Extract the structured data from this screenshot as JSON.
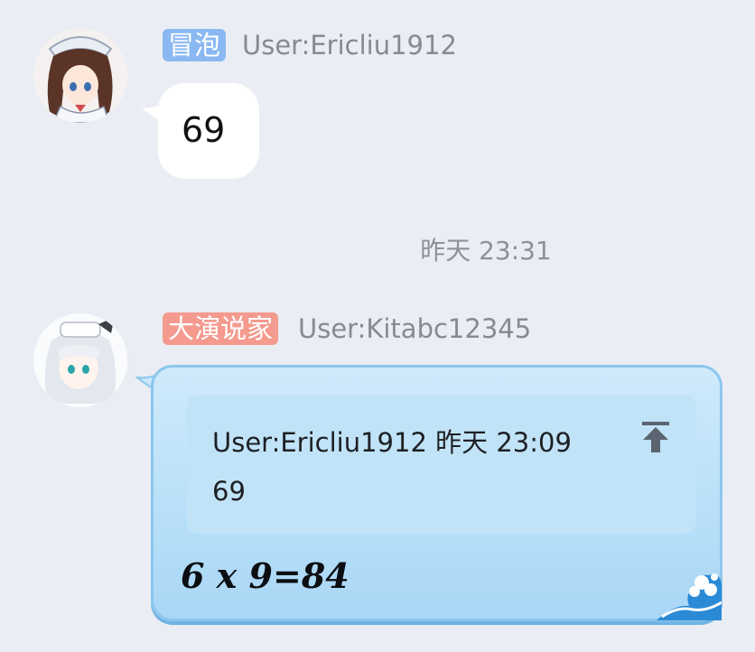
{
  "messages": [
    {
      "badge": "冒泡",
      "badge_color": "#8ab8f2",
      "username": "User:Ericliu1912",
      "text": "69"
    },
    {
      "badge": "大演说家",
      "badge_color": "#f49a8e",
      "username": "User:Kitabc12345",
      "quote": {
        "header": "User:Ericliu1912 昨天 23:09",
        "body": "69"
      },
      "text": "6 x 9=84"
    }
  ],
  "timestamp": "昨天 23:31",
  "icons": {
    "pin": "pin-to-top-icon",
    "wave": "wave-decoration-icon"
  }
}
